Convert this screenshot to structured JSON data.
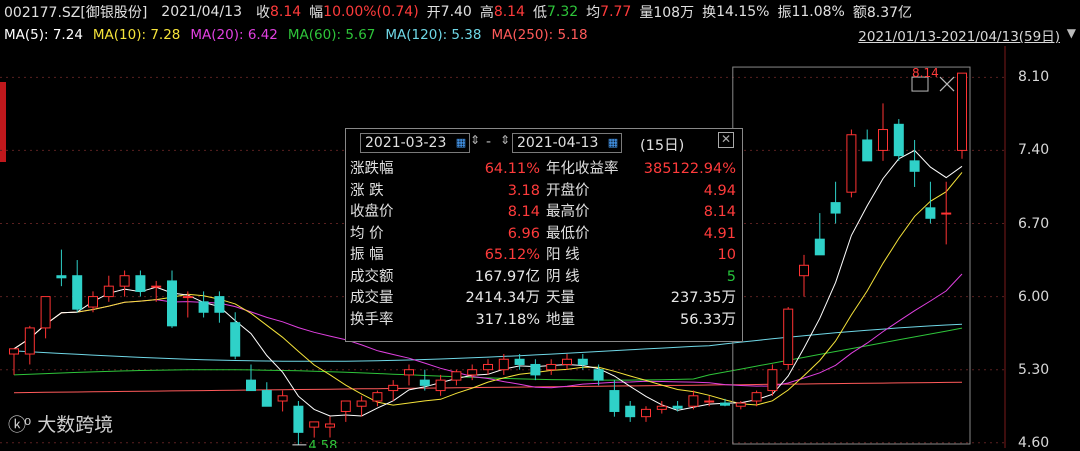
{
  "header": {
    "code": "002177.SZ[御银股份]",
    "date": "2021/04/13",
    "close_label": "收",
    "close_value": "8.14",
    "chg_label": "幅",
    "chg_value": "10.00%(0.74)",
    "open_label": "开",
    "open_value": "7.40",
    "high_label": "高",
    "high_value": "8.14",
    "low_label": "低",
    "low_value": "7.32",
    "avg_label": "均",
    "avg_value": "7.77",
    "vol_label": "量",
    "vol_value": "108万",
    "turn_label": "换",
    "turn_value": "14.15%",
    "amp_label": "振",
    "amp_value": "11.08%",
    "amt_label": "额",
    "amt_value": "8.37亿"
  },
  "ma": [
    {
      "text": "MA(5): 7.24",
      "color": "#ffffff"
    },
    {
      "text": "MA(10): 7.28",
      "color": "#f5e33a"
    },
    {
      "text": "MA(20): 6.42",
      "color": "#e040e0"
    },
    {
      "text": "MA(60): 5.67",
      "color": "#2ec43a"
    },
    {
      "text": "MA(120): 5.38",
      "color": "#6fd7e6"
    },
    {
      "text": "MA(250): 5.18",
      "color": "#ff5a5a"
    }
  ],
  "range_text": "2021/01/13-2021/04/13(59日)",
  "chart_data": {
    "type": "candlestick",
    "y_ticks": [
      "8.10",
      "7.40",
      "6.70",
      "6.00",
      "5.30",
      "4.60"
    ],
    "y_tick_values": [
      8.1,
      7.4,
      6.7,
      6.0,
      5.3,
      4.6
    ],
    "ylim": [
      4.55,
      8.4
    ],
    "low_annotation": "4.58",
    "high_annotation": "8.14",
    "candles": [
      [
        5.45,
        5.5,
        5.25,
        5.5
      ],
      [
        5.45,
        5.72,
        5.35,
        5.7
      ],
      [
        5.7,
        6.0,
        5.6,
        6.0
      ],
      [
        6.2,
        6.45,
        6.1,
        6.18
      ],
      [
        6.2,
        6.35,
        5.85,
        5.88
      ],
      [
        5.9,
        6.05,
        5.85,
        6.0
      ],
      [
        6.0,
        6.2,
        5.95,
        6.1
      ],
      [
        6.1,
        6.25,
        6.0,
        6.2
      ],
      [
        6.2,
        6.25,
        6.0,
        6.05
      ],
      [
        6.1,
        6.15,
        5.95,
        6.1
      ],
      [
        6.15,
        6.25,
        5.7,
        5.72
      ],
      [
        6.0,
        6.05,
        5.8,
        6.0
      ],
      [
        5.95,
        6.05,
        5.8,
        5.85
      ],
      [
        6.0,
        6.05,
        5.75,
        5.85
      ],
      [
        5.75,
        5.85,
        5.4,
        5.43
      ],
      [
        5.2,
        5.35,
        5.1,
        5.1
      ],
      [
        5.1,
        5.18,
        4.95,
        4.95
      ],
      [
        5.0,
        5.1,
        4.9,
        5.05
      ],
      [
        4.95,
        5.0,
        4.58,
        4.7
      ],
      [
        4.75,
        4.8,
        4.65,
        4.8
      ],
      [
        4.75,
        4.85,
        4.65,
        4.78
      ],
      [
        4.9,
        5.0,
        4.8,
        5.0
      ],
      [
        4.95,
        5.05,
        4.85,
        5.0
      ],
      [
        5.0,
        5.1,
        4.95,
        5.08
      ],
      [
        5.1,
        5.2,
        5.0,
        5.15
      ],
      [
        5.25,
        5.35,
        5.15,
        5.3
      ],
      [
        5.2,
        5.3,
        5.1,
        5.15
      ],
      [
        5.1,
        5.25,
        5.05,
        5.2
      ],
      [
        5.2,
        5.3,
        5.15,
        5.28
      ],
      [
        5.25,
        5.35,
        5.2,
        5.3
      ],
      [
        5.3,
        5.4,
        5.25,
        5.35
      ],
      [
        5.3,
        5.45,
        5.25,
        5.4
      ],
      [
        5.4,
        5.45,
        5.3,
        5.35
      ],
      [
        5.35,
        5.4,
        5.2,
        5.25
      ],
      [
        5.3,
        5.4,
        5.25,
        5.35
      ],
      [
        5.35,
        5.45,
        5.3,
        5.4
      ],
      [
        5.4,
        5.45,
        5.3,
        5.35
      ],
      [
        5.3,
        5.35,
        5.15,
        5.2
      ],
      [
        5.1,
        5.2,
        4.85,
        4.9
      ],
      [
        4.95,
        5.0,
        4.8,
        4.85
      ],
      [
        4.85,
        4.95,
        4.8,
        4.92
      ],
      [
        4.92,
        5.0,
        4.88,
        4.95
      ],
      [
        4.95,
        5.0,
        4.9,
        4.93
      ],
      [
        4.95,
        5.1,
        4.92,
        5.05
      ],
      [
        5.0,
        5.05,
        4.95,
        5.0
      ],
      [
        4.98,
        5.02,
        4.95,
        4.96
      ],
      [
        4.95,
        5.0,
        4.92,
        4.98
      ],
      [
        5.0,
        5.1,
        4.95,
        5.08
      ],
      [
        5.1,
        5.35,
        5.05,
        5.3
      ],
      [
        5.35,
        5.9,
        5.3,
        5.88
      ],
      [
        6.2,
        6.4,
        6.0,
        6.3
      ],
      [
        6.55,
        6.8,
        6.4,
        6.4
      ],
      [
        6.9,
        7.1,
        6.7,
        6.8
      ],
      [
        7.0,
        7.6,
        6.95,
        7.55
      ],
      [
        7.5,
        7.6,
        7.3,
        7.3
      ],
      [
        7.4,
        7.85,
        7.3,
        7.6
      ],
      [
        7.65,
        7.7,
        7.3,
        7.35
      ],
      [
        7.3,
        7.5,
        7.05,
        7.2
      ],
      [
        6.85,
        7.1,
        6.7,
        6.75
      ],
      [
        6.8,
        7.1,
        6.5,
        6.8
      ],
      [
        7.4,
        8.14,
        7.32,
        8.14
      ]
    ]
  },
  "popup": {
    "start_date": "2021-03-23",
    "end_date": "2021-04-13",
    "days": "(15日)",
    "stepper_left": "▲▼",
    "dash": "-",
    "rows": [
      {
        "l1": "涨跌幅",
        "v1": "64.11%",
        "c1": "red",
        "l2": "年化收益率",
        "v2": "385122.94%",
        "c2": "red"
      },
      {
        "l1": "涨  跌",
        "v1": "3.18",
        "c1": "red",
        "l2": "开盘价",
        "v2": "4.94",
        "c2": "red"
      },
      {
        "l1": "收盘价",
        "v1": "8.14",
        "c1": "red",
        "l2": "最高价",
        "v2": "8.14",
        "c2": "red"
      },
      {
        "l1": "均  价",
        "v1": "6.96",
        "c1": "red",
        "l2": "最低价",
        "v2": "4.91",
        "c2": "red"
      },
      {
        "l1": "振  幅",
        "v1": "65.12%",
        "c1": "red",
        "l2": "阳  线",
        "v2": "10",
        "c2": "red"
      },
      {
        "l1": "成交额",
        "v1": "167.97亿",
        "c1": "wht",
        "l2": "阴  线",
        "v2": "5",
        "c2": "grn"
      },
      {
        "l1": "成交量",
        "v1": "2414.34万",
        "c1": "wht",
        "l2": "天量",
        "v2": "237.35万",
        "c2": "wht"
      },
      {
        "l1": "换手率",
        "v1": "317.18%",
        "c1": "wht",
        "l2": "地量",
        "v2": "56.33万",
        "c2": "wht"
      }
    ]
  },
  "logo_text": "大数跨境",
  "colors": {
    "up": "#ff3333",
    "down": "#2fd1c8",
    "grid": "#5a2020"
  }
}
